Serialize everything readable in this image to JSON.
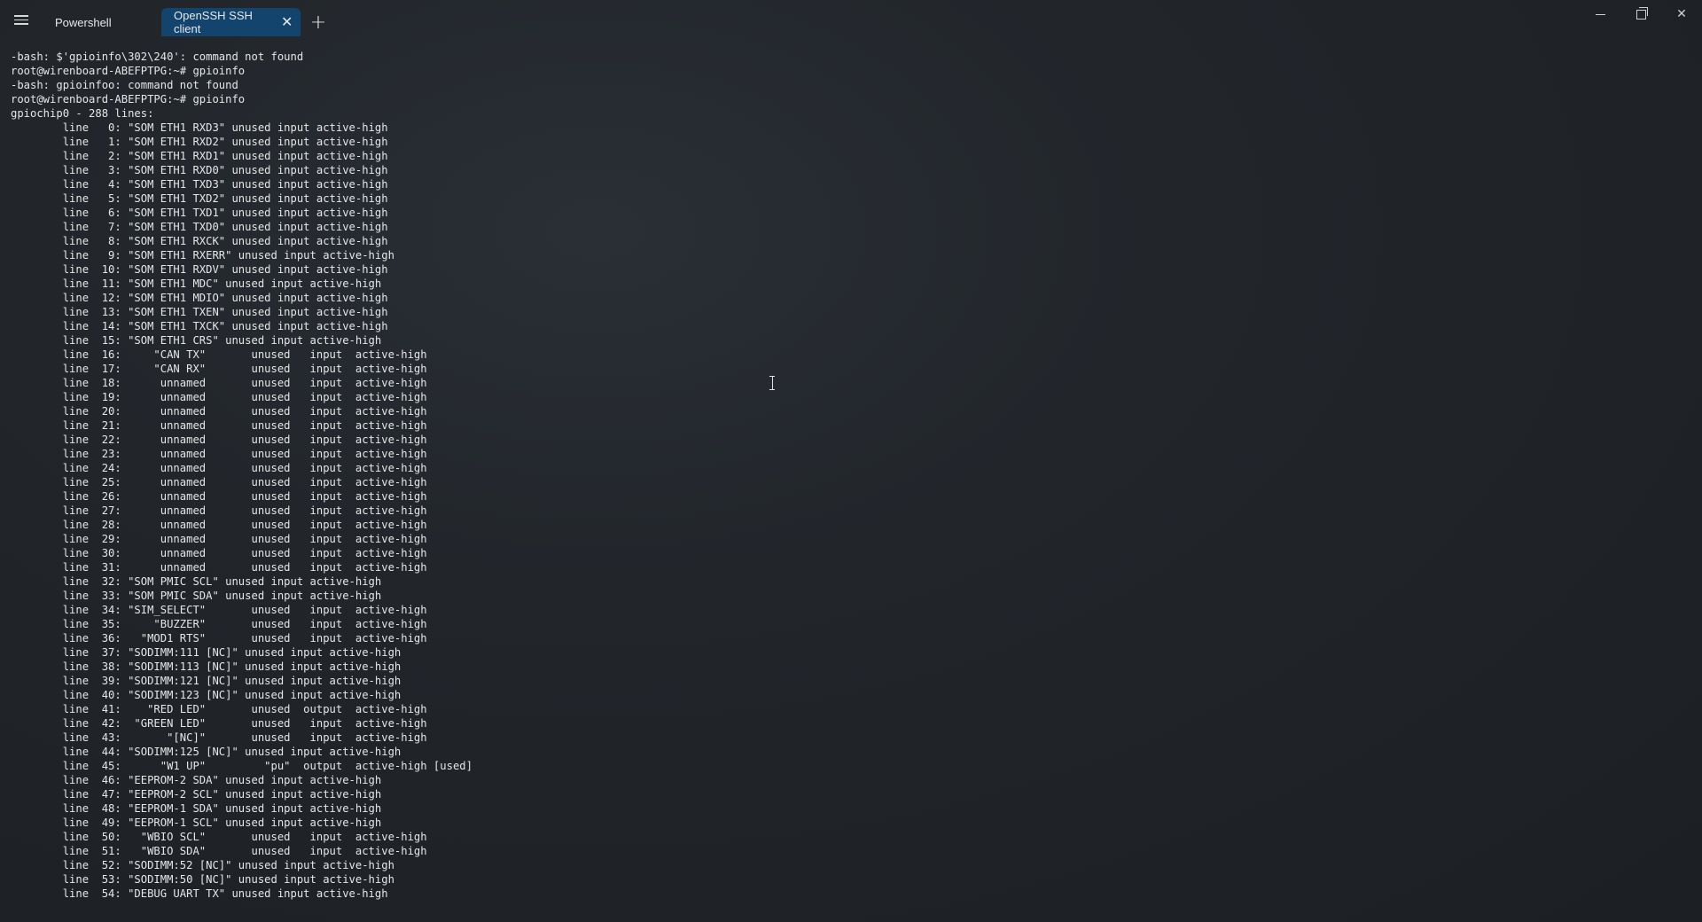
{
  "titlebar": {
    "tabs": [
      {
        "label": "Powershell",
        "active": false
      },
      {
        "label": "OpenSSH SSH client",
        "active": true
      }
    ],
    "close_glyph": "✕",
    "new_tab_glyph": "+",
    "window_controls": {
      "minimize": "minimize-icon",
      "maximize": "restore-icon",
      "close_glyph": "✕"
    }
  },
  "colors": {
    "active_tab": "#12446e",
    "background": "#22262b",
    "text": "#e6e6e6"
  },
  "terminal": {
    "lines": [
      "-bash: $'gpioinfo\\302\\240': command not found",
      "root@wirenboard-ABEFPTPG:~# gpioinfo",
      "-bash: gpioinfoo: command not found",
      "root@wirenboard-ABEFPTPG:~# gpioinfo",
      "gpiochip0 - 288 lines:",
      "        line   0: \"SOM ETH1 RXD3\" unused input active-high",
      "        line   1: \"SOM ETH1 RXD2\" unused input active-high",
      "        line   2: \"SOM ETH1 RXD1\" unused input active-high",
      "        line   3: \"SOM ETH1 RXD0\" unused input active-high",
      "        line   4: \"SOM ETH1 TXD3\" unused input active-high",
      "        line   5: \"SOM ETH1 TXD2\" unused input active-high",
      "        line   6: \"SOM ETH1 TXD1\" unused input active-high",
      "        line   7: \"SOM ETH1 TXD0\" unused input active-high",
      "        line   8: \"SOM ETH1 RXCK\" unused input active-high",
      "        line   9: \"SOM ETH1 RXERR\" unused input active-high",
      "        line  10: \"SOM ETH1 RXDV\" unused input active-high",
      "        line  11: \"SOM ETH1 MDC\" unused input active-high",
      "        line  12: \"SOM ETH1 MDIO\" unused input active-high",
      "        line  13: \"SOM ETH1 TXEN\" unused input active-high",
      "        line  14: \"SOM ETH1 TXCK\" unused input active-high",
      "        line  15: \"SOM ETH1 CRS\" unused input active-high",
      "        line  16:     \"CAN TX\"       unused   input  active-high",
      "        line  17:     \"CAN RX\"       unused   input  active-high",
      "        line  18:      unnamed       unused   input  active-high",
      "        line  19:      unnamed       unused   input  active-high",
      "        line  20:      unnamed       unused   input  active-high",
      "        line  21:      unnamed       unused   input  active-high",
      "        line  22:      unnamed       unused   input  active-high",
      "        line  23:      unnamed       unused   input  active-high",
      "        line  24:      unnamed       unused   input  active-high",
      "        line  25:      unnamed       unused   input  active-high",
      "        line  26:      unnamed       unused   input  active-high",
      "        line  27:      unnamed       unused   input  active-high",
      "        line  28:      unnamed       unused   input  active-high",
      "        line  29:      unnamed       unused   input  active-high",
      "        line  30:      unnamed       unused   input  active-high",
      "        line  31:      unnamed       unused   input  active-high",
      "        line  32: \"SOM PMIC SCL\" unused input active-high",
      "        line  33: \"SOM PMIC SDA\" unused input active-high",
      "        line  34: \"SIM_SELECT\"       unused   input  active-high",
      "        line  35:     \"BUZZER\"       unused   input  active-high",
      "        line  36:   \"MOD1 RTS\"       unused   input  active-high",
      "        line  37: \"SODIMM:111 [NC]\" unused input active-high",
      "        line  38: \"SODIMM:113 [NC]\" unused input active-high",
      "        line  39: \"SODIMM:121 [NC]\" unused input active-high",
      "        line  40: \"SODIMM:123 [NC]\" unused input active-high",
      "        line  41:    \"RED LED\"       unused  output  active-high",
      "        line  42:  \"GREEN LED\"       unused   input  active-high",
      "        line  43:       \"[NC]\"       unused   input  active-high",
      "        line  44: \"SODIMM:125 [NC]\" unused input active-high",
      "        line  45:      \"W1 UP\"         \"pu\"  output  active-high [used]",
      "        line  46: \"EEPROM-2 SDA\" unused input active-high",
      "        line  47: \"EEPROM-2 SCL\" unused input active-high",
      "        line  48: \"EEPROM-1 SDA\" unused input active-high",
      "        line  49: \"EEPROM-1 SCL\" unused input active-high",
      "        line  50:   \"WBIO SCL\"       unused   input  active-high",
      "        line  51:   \"WBIO SDA\"       unused   input  active-high",
      "        line  52: \"SODIMM:52 [NC]\" unused input active-high",
      "        line  53: \"SODIMM:50 [NC]\" unused input active-high",
      "        line  54: \"DEBUG UART TX\" unused input active-high"
    ]
  }
}
